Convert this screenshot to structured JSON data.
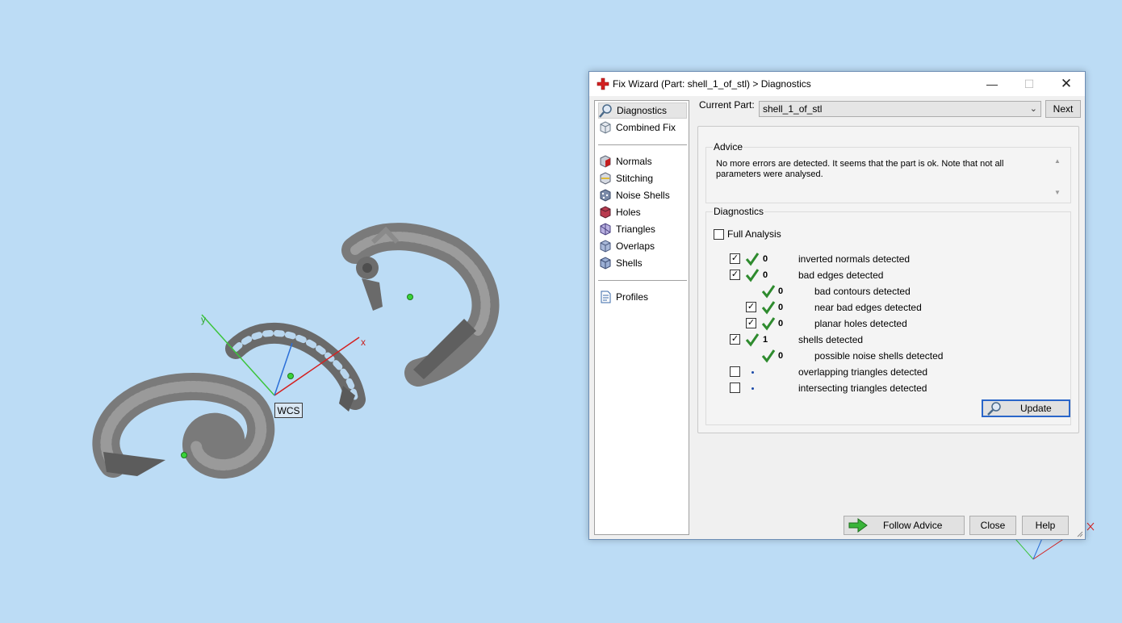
{
  "viewport": {
    "wcs_label": "WCS",
    "axis_x_label": "x",
    "axis_y_label": "y"
  },
  "dialog": {
    "title": "Fix Wizard (Part: shell_1_of_stl) > Diagnostics",
    "window_controls": {
      "minimize": "—",
      "maximize": "☐",
      "close": "✕"
    },
    "nav": {
      "items_top": [
        {
          "label": "Diagnostics",
          "icon": "magnifier-icon"
        },
        {
          "label": "Combined Fix",
          "icon": "cube-icon"
        }
      ],
      "items_mid": [
        {
          "label": "Normals",
          "icon": "normals-cube-icon"
        },
        {
          "label": "Stitching",
          "icon": "stitching-cube-icon"
        },
        {
          "label": "Noise Shells",
          "icon": "noise-shells-icon"
        },
        {
          "label": "Holes",
          "icon": "holes-cube-icon"
        },
        {
          "label": "Triangles",
          "icon": "triangles-cube-icon"
        },
        {
          "label": "Overlaps",
          "icon": "overlaps-cube-icon"
        },
        {
          "label": "Shells",
          "icon": "shells-cube-icon"
        }
      ],
      "items_bottom": [
        {
          "label": "Profiles",
          "icon": "document-icon"
        }
      ]
    },
    "current_part_label": "Current Part:",
    "current_part_value": "shell_1_of_stl",
    "next_label": "Next",
    "advice": {
      "title": "Advice",
      "text": "No more errors are detected. It seems that the part is ok. Note that not all parameters were analysed."
    },
    "diagnostics": {
      "title": "Diagnostics",
      "full_analysis_label": "Full Analysis",
      "full_analysis_checked": false,
      "rows": [
        {
          "checkbox": true,
          "checked": true,
          "status": "ok",
          "count": "0",
          "label": "inverted normals detected"
        },
        {
          "checkbox": true,
          "checked": true,
          "status": "ok",
          "count": "0",
          "label": "bad edges detected"
        },
        {
          "checkbox": false,
          "checked": false,
          "status": "ok",
          "count": "0",
          "label": "bad contours detected"
        },
        {
          "checkbox": true,
          "checked": true,
          "status": "ok",
          "count": "0",
          "label": "near bad edges detected"
        },
        {
          "checkbox": true,
          "checked": true,
          "status": "ok",
          "count": "0",
          "label": "planar holes detected"
        },
        {
          "checkbox": true,
          "checked": true,
          "status": "ok",
          "count": "1",
          "label": "shells detected"
        },
        {
          "checkbox": false,
          "checked": false,
          "status": "ok",
          "count": "0",
          "label": "possible noise shells detected"
        },
        {
          "checkbox": true,
          "checked": false,
          "status": "not-analysed",
          "count": "",
          "label": "overlapping triangles detected"
        },
        {
          "checkbox": true,
          "checked": false,
          "status": "not-analysed",
          "count": "",
          "label": "intersecting triangles detected"
        }
      ],
      "update_label": "Update"
    },
    "buttons": {
      "follow_advice": "Follow Advice",
      "close": "Close",
      "help": "Help"
    }
  },
  "colors": {
    "background": "#bcdcf5",
    "ok_check": "#2e8b2e",
    "title_icon": "#d32020"
  }
}
